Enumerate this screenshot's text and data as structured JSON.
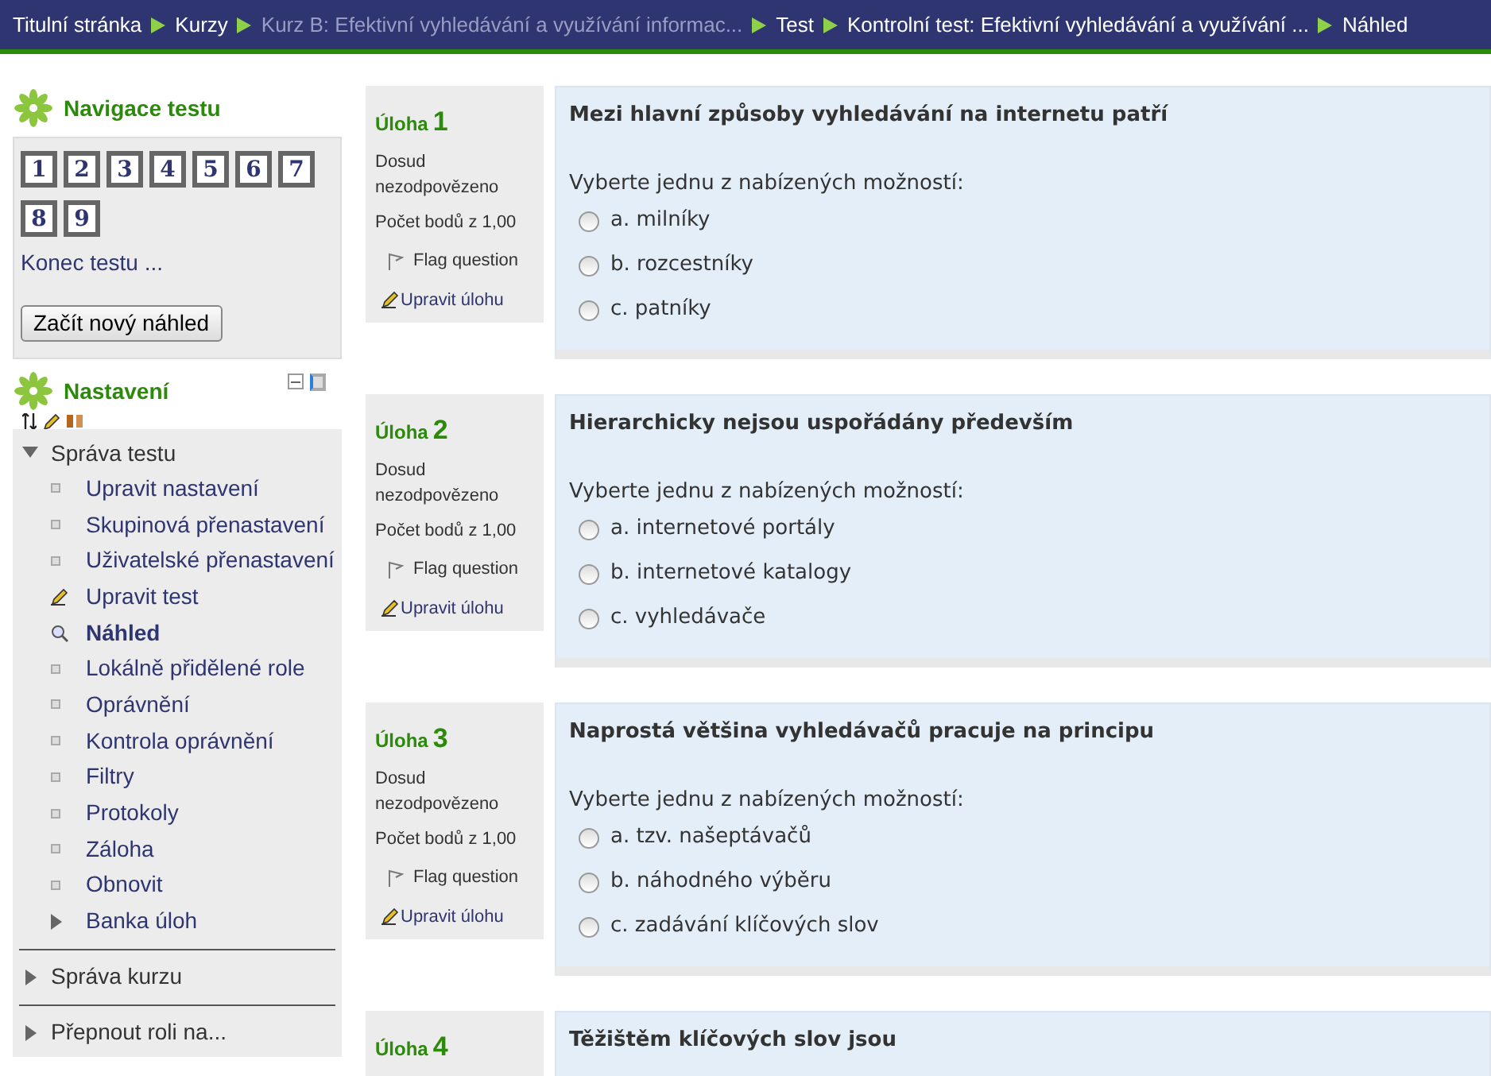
{
  "breadcrumb": [
    {
      "label": "Titulní stránka",
      "dimmed": false
    },
    {
      "label": "Kurzy",
      "dimmed": false
    },
    {
      "label": "Kurz B: Efektivní vyhledávání a využívání informac...",
      "dimmed": true
    },
    {
      "label": "Test",
      "dimmed": false
    },
    {
      "label": "Kontrolní test: Efektivní vyhledávání a využívání ...",
      "dimmed": false
    },
    {
      "label": "Náhled",
      "dimmed": false
    }
  ],
  "quiz_navigation": {
    "title": "Navigace testu",
    "buttons": [
      "1",
      "2",
      "3",
      "4",
      "5",
      "6",
      "7",
      "8",
      "9"
    ],
    "finish_link": "Konec testu ...",
    "new_preview_button": "Začít nový náhled"
  },
  "settings": {
    "title": "Nastavení",
    "tree": [
      {
        "label": "Správa testu",
        "expanded": true,
        "children": [
          {
            "label": "Upravit nastavení",
            "kind": "leaf",
            "selected": false
          },
          {
            "label": "Skupinová přenastavení",
            "kind": "leaf",
            "selected": false
          },
          {
            "label": "Uživatelské přenastavení",
            "kind": "leaf",
            "selected": false
          },
          {
            "label": "Upravit test",
            "kind": "edit",
            "selected": false
          },
          {
            "label": "Náhled",
            "kind": "preview",
            "selected": true
          },
          {
            "label": "Lokálně přidělené role",
            "kind": "leaf",
            "selected": false
          },
          {
            "label": "Oprávnění",
            "kind": "leaf",
            "selected": false
          },
          {
            "label": "Kontrola oprávnění",
            "kind": "leaf",
            "selected": false
          },
          {
            "label": "Filtry",
            "kind": "leaf",
            "selected": false
          },
          {
            "label": "Protokoly",
            "kind": "leaf",
            "selected": false
          },
          {
            "label": "Záloha",
            "kind": "leaf",
            "selected": false
          },
          {
            "label": "Obnovit",
            "kind": "leaf",
            "selected": false
          },
          {
            "label": "Banka úloh",
            "kind": "branch",
            "selected": false
          }
        ]
      },
      {
        "label": "Správa kurzu",
        "expanded": false
      },
      {
        "label": "Přepnout roli na...",
        "expanded": false
      }
    ]
  },
  "questions": [
    {
      "label": "Úloha",
      "number": "1",
      "status": "Dosud nezodpovězeno",
      "points": "Počet bodů z 1,00",
      "flag": "Flag question",
      "edit": "Upravit úlohu",
      "text": "Mezi hlavní způsoby vyhledávání na internetu patří",
      "prompt": "Vyberte jednu z nabízených možností:",
      "options": [
        {
          "label": "a. milníky",
          "selected": false
        },
        {
          "label": "b. rozcestníky",
          "selected": false
        },
        {
          "label": "c. patníky",
          "selected": false
        }
      ]
    },
    {
      "label": "Úloha",
      "number": "2",
      "status": "Dosud nezodpovězeno",
      "points": "Počet bodů z 1,00",
      "flag": "Flag question",
      "edit": "Upravit úlohu",
      "text": "Hierarchicky nejsou uspořádány především",
      "prompt": "Vyberte jednu z nabízených možností:",
      "options": [
        {
          "label": "a. internetové portály",
          "selected": false
        },
        {
          "label": "b. internetové katalogy",
          "selected": false
        },
        {
          "label": "c. vyhledávače",
          "selected": false
        }
      ]
    },
    {
      "label": "Úloha",
      "number": "3",
      "status": "Dosud nezodpovězeno",
      "points": "Počet bodů z 1,00",
      "flag": "Flag question",
      "edit": "Upravit úlohu",
      "text": "Naprostá většina vyhledávačů pracuje na principu",
      "prompt": "Vyberte jednu z nabízených možností:",
      "options": [
        {
          "label": "a. tzv. našeptávačů",
          "selected": false
        },
        {
          "label": "b. náhodného výběru",
          "selected": false
        },
        {
          "label": "c. zadávání klíčových slov",
          "selected": false
        }
      ]
    },
    {
      "label": "Úloha",
      "number": "4",
      "text": "Těžištěm klíčových slov jsou"
    }
  ]
}
